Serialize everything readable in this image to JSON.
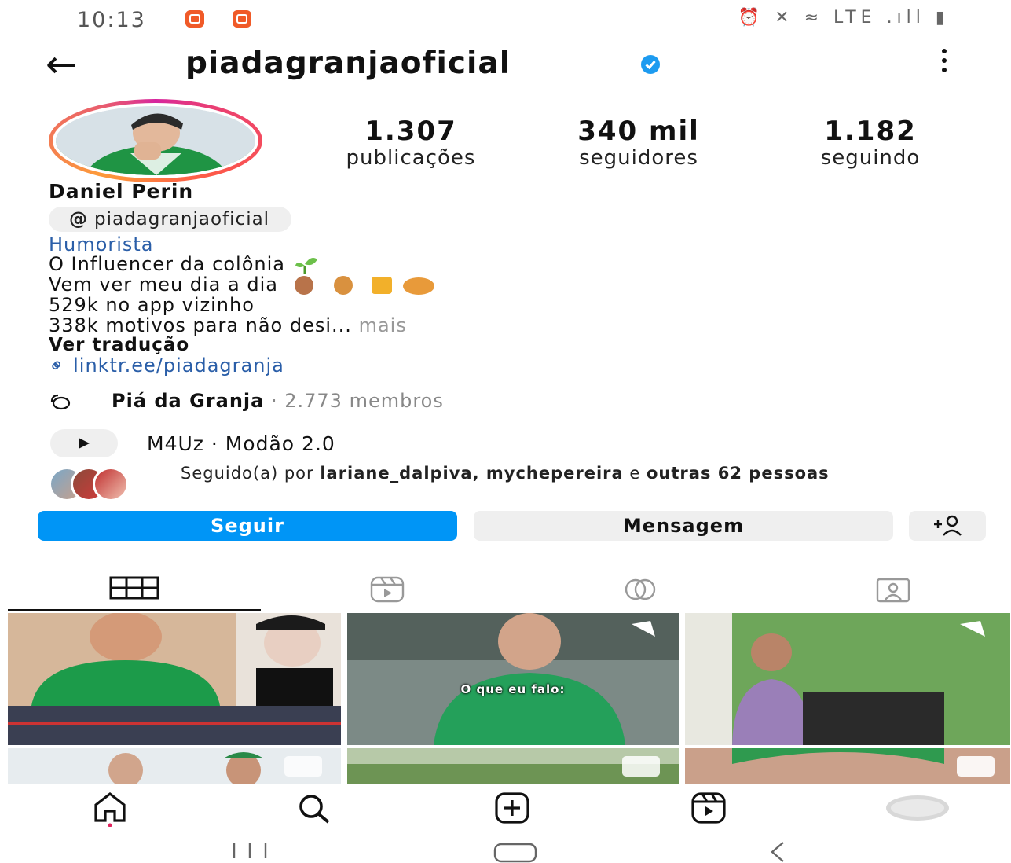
{
  "status_bar": {
    "time": "10:13",
    "icons_text": "⏰ ✕ ≈ LTE .ıll ▮"
  },
  "header": {
    "username": "piadagranjaoficial"
  },
  "stats": {
    "posts": {
      "value": "1.307",
      "label": "publicações"
    },
    "followers": {
      "value": "340 mil",
      "label": "seguidores"
    },
    "following": {
      "value": "1.182",
      "label": "seguindo"
    }
  },
  "bio": {
    "display_name": "Daniel Perin",
    "threads_handle": "piadagranjaoficial",
    "category": "Humorista",
    "lines": [
      "O Influencer da colônia",
      "Vem ver meu dia a dia",
      "529k no app vizinho",
      "338k motivos para não desi..."
    ],
    "more": "mais",
    "see_translation": "Ver tradução",
    "link": "linktr.ee/piadagranja"
  },
  "channel": {
    "name": "Piá da Granja",
    "separator": " · ",
    "members": "2.773 membros"
  },
  "music": {
    "track": "M4Uz · Modão 2.0"
  },
  "followed_by": {
    "prefix": "Seguido(a) por ",
    "names": "lariane_dalpiva, mychepereira",
    "conj": " e ",
    "others": "outras 62 pessoas"
  },
  "actions": {
    "follow": "Seguir",
    "message": "Mensagem"
  },
  "posts": [
    {
      "caption": ""
    },
    {
      "caption": "O que eu falo:"
    },
    {
      "caption": ""
    }
  ],
  "colors": {
    "accent": "#0095f6",
    "link": "#2a5ea8",
    "verified": "#1d9bf0"
  },
  "icons": [
    "back-arrow-icon",
    "verified-icon",
    "more-icon",
    "threads-icon",
    "link-icon",
    "channel-icon",
    "play-icon",
    "add-person-icon",
    "grid-icon",
    "reels-icon",
    "collab-icon",
    "tagged-icon",
    "home-icon",
    "search-icon",
    "create-icon",
    "reels-nav-icon",
    "profile-icon"
  ]
}
